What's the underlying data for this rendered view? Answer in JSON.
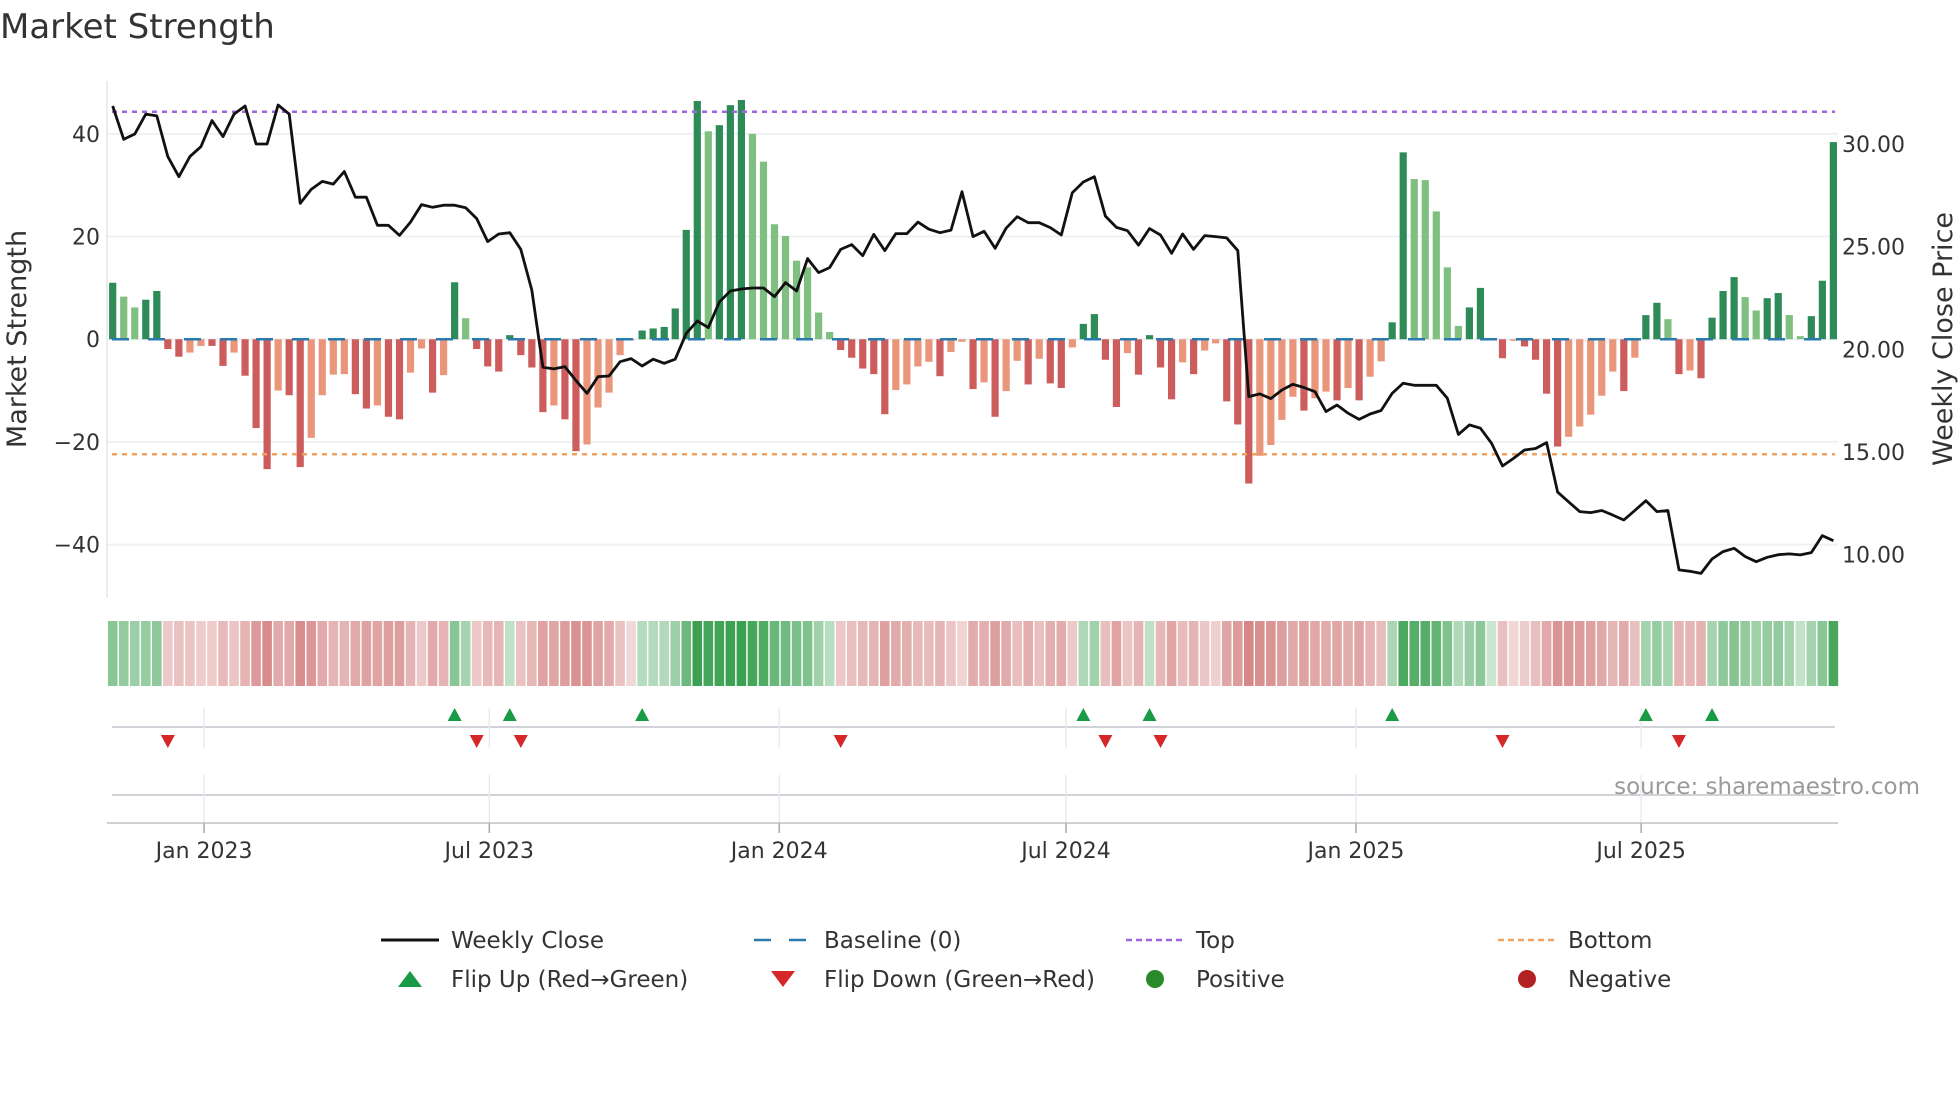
{
  "title": "Market Strength",
  "source": "source: sharemaestro.com",
  "colors": {
    "pos_rising": "#2e8b57",
    "pos_falling": "#7fbf7f",
    "neg_falling": "#cd5c5c",
    "neg_rising": "#e9967a",
    "close": "#111111",
    "baseline": "#2a7ab0",
    "top": "#a066e0",
    "bottom": "#f0a35e",
    "flip_up": "#1a9a47",
    "flip_down": "#d62728",
    "positive": "#2a8a2a",
    "negative": "#b22222"
  },
  "chart_data": {
    "type": "bar+line",
    "title": "Market Strength",
    "ylabel": "Market Strength",
    "y2label": "Weekly Close Price",
    "frequency": "weekly",
    "start_date": "2022-11-04",
    "ylim": [
      -50.4,
      50.3
    ],
    "y2lim": [
      7.4,
      32.58
    ],
    "yticks": [
      40,
      20,
      0,
      -20,
      -40
    ],
    "ytick_labels": [
      "40",
      "20",
      "0",
      "−20",
      "−40"
    ],
    "y2ticks": [
      30,
      25,
      20,
      15,
      10
    ],
    "y2tick_labels": [
      "30.00",
      "25.00",
      "20.00",
      "15.00",
      "10.00"
    ],
    "xticks": [
      {
        "date": "2023-01-01",
        "label": "Jan 2023"
      },
      {
        "date": "2023-07-01",
        "label": "Jul 2023"
      },
      {
        "date": "2024-01-01",
        "label": "Jan 2024"
      },
      {
        "date": "2024-07-01",
        "label": "Jul 2024"
      },
      {
        "date": "2025-01-01",
        "label": "Jan 2025"
      },
      {
        "date": "2025-07-01",
        "label": "Jul 2025"
      }
    ],
    "top_level": 44.3,
    "bottom_level": -22.4,
    "baseline": 0,
    "strength": [
      11.0,
      8.3,
      6.2,
      7.7,
      9.4,
      -1.9,
      -3.4,
      -2.6,
      -1.3,
      -1.3,
      -5.2,
      -2.6,
      -7.1,
      -17.3,
      -25.3,
      -10.0,
      -10.9,
      -24.9,
      -19.2,
      -10.9,
      -6.9,
      -6.8,
      -10.7,
      -13.5,
      -12.9,
      -15.1,
      -15.6,
      -6.5,
      -1.8,
      -10.4,
      -7.0,
      11.1,
      4.1,
      -1.9,
      -5.3,
      -6.3,
      0.8,
      -3.1,
      -5.5,
      -14.2,
      -12.9,
      -15.6,
      -21.8,
      -20.5,
      -13.3,
      -10.4,
      -3.1,
      -0.2,
      1.7,
      2.1,
      2.4,
      6.0,
      21.3,
      46.4,
      40.5,
      41.7,
      45.6,
      46.6,
      40.0,
      34.6,
      22.4,
      20.1,
      15.3,
      14.0,
      5.2,
      1.4,
      -2.1,
      -3.6,
      -5.7,
      -6.8,
      -14.6,
      -9.9,
      -8.8,
      -5.3,
      -4.4,
      -7.2,
      -2.5,
      -0.5,
      -9.7,
      -8.4,
      -15.1,
      -10.1,
      -4.2,
      -8.8,
      -3.8,
      -8.6,
      -9.5,
      -1.6,
      3.0,
      4.9,
      -4.0,
      -13.2,
      -2.7,
      -6.9,
      0.8,
      -5.5,
      -11.7,
      -4.5,
      -6.8,
      -2.2,
      -0.8,
      -12.1,
      -16.6,
      -28.1,
      -22.7,
      -20.6,
      -15.7,
      -11.2,
      -13.9,
      -11.5,
      -10.2,
      -11.9,
      -9.5,
      -11.9,
      -7.3,
      -4.3,
      3.3,
      36.4,
      31.2,
      31.0,
      24.9,
      14.0,
      2.6,
      6.2,
      10.0,
      0.2,
      -3.7,
      -0.3,
      -1.4,
      -4.0,
      -10.6,
      -20.9,
      -19.0,
      -17.0,
      -14.7,
      -11.0,
      -6.3,
      -10.1,
      -3.6,
      4.7,
      7.1,
      3.9,
      -6.8,
      -6.1,
      -7.6,
      4.2,
      9.4,
      12.1,
      8.2,
      5.6,
      8.0,
      9.0,
      4.7,
      0.6,
      4.5,
      11.4,
      38.4
    ],
    "weekly_close": [
      31.36,
      29.74,
      30.0,
      30.97,
      30.88,
      28.9,
      27.92,
      28.9,
      29.38,
      30.65,
      29.87,
      30.97,
      31.36,
      29.51,
      29.51,
      31.41,
      30.97,
      26.62,
      27.3,
      27.69,
      27.56,
      28.17,
      26.92,
      26.92,
      25.55,
      25.55,
      25.06,
      25.71,
      26.56,
      26.43,
      26.53,
      26.53,
      26.41,
      25.88,
      24.76,
      25.13,
      25.19,
      24.38,
      22.4,
      18.64,
      18.56,
      18.67,
      17.99,
      17.37,
      18.18,
      18.21,
      18.91,
      19.06,
      18.7,
      19.03,
      18.83,
      19.03,
      20.29,
      20.89,
      20.57,
      21.82,
      22.35,
      22.45,
      22.5,
      22.5,
      22.08,
      22.76,
      22.35,
      23.93,
      23.25,
      23.49,
      24.38,
      24.61,
      24.07,
      25.11,
      24.32,
      25.15,
      25.15,
      25.71,
      25.36,
      25.19,
      25.32,
      27.19,
      25.0,
      25.26,
      24.43,
      25.41,
      25.97,
      25.68,
      25.68,
      25.44,
      25.08,
      27.14,
      27.66,
      27.92,
      26.0,
      25.45,
      25.29,
      24.59,
      25.39,
      25.08,
      24.19,
      25.13,
      24.38,
      25.05,
      25.0,
      24.94,
      24.32,
      17.21,
      17.34,
      17.11,
      17.53,
      17.81,
      17.65,
      17.45,
      16.48,
      16.8,
      16.4,
      16.1,
      16.36,
      16.53,
      17.37,
      17.86,
      17.76,
      17.76,
      17.76,
      17.13,
      15.37,
      15.83,
      15.67,
      14.94,
      13.83,
      14.2,
      14.61,
      14.68,
      14.97,
      12.56,
      12.08,
      11.61,
      11.56,
      11.66,
      11.44,
      11.2,
      11.66,
      12.14,
      11.61,
      11.66,
      8.77,
      8.7,
      8.6,
      9.3,
      9.66,
      9.82,
      9.42,
      9.17,
      9.38,
      9.51,
      9.55,
      9.5,
      9.61,
      10.44,
      10.19
    ],
    "flip_up_weeks": [
      32,
      37,
      49,
      89,
      95,
      117,
      140,
      146
    ],
    "flip_down_weeks": [
      6,
      34,
      38,
      67,
      91,
      96,
      127,
      143
    ],
    "legend": [
      {
        "label": "Weekly Close",
        "kind": "line-solid",
        "color_key": "close"
      },
      {
        "label": "Baseline (0)",
        "kind": "line-dashed",
        "color_key": "baseline"
      },
      {
        "label": "Top",
        "kind": "line-dotted",
        "color_key": "top"
      },
      {
        "label": "Bottom",
        "kind": "line-dotted",
        "color_key": "bottom"
      },
      {
        "label": "Flip Up (Red→Green)",
        "kind": "triangle-up",
        "color_key": "flip_up"
      },
      {
        "label": "Flip Down (Green→Red)",
        "kind": "triangle-down",
        "color_key": "flip_down"
      },
      {
        "label": "Positive",
        "kind": "dot",
        "color_key": "positive"
      },
      {
        "label": "Negative",
        "kind": "dot",
        "color_key": "negative"
      }
    ],
    "legend_position": "bottom-center"
  }
}
